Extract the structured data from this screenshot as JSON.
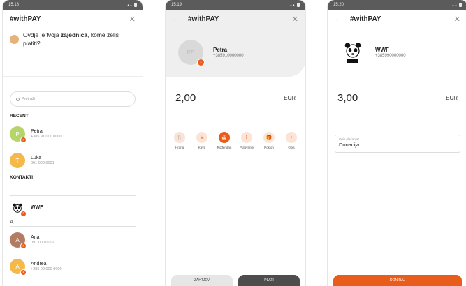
{
  "brand": {
    "accent": "#e85c1c",
    "status_bar": "#5b5b5b"
  },
  "screen1": {
    "time": "15:18",
    "title": "#withPAY",
    "intro_pre": "Ovdje je tvoja ",
    "intro_bold": "zajednica",
    "intro_post": ", kome želiš platiti?",
    "search_placeholder": "Pretraži",
    "recent_label": "RECENT",
    "contacts_label": "KONTAKTI",
    "letter_a": "A",
    "recent": [
      {
        "initial": "P",
        "name": "Petra",
        "phone": "+385 91 000 0000",
        "color": "#b5d46a"
      },
      {
        "initial": "T",
        "name": "Luka",
        "phone": "091 000 0001",
        "color": "#f5b94a"
      }
    ],
    "wwf_name": "WWF",
    "contacts": [
      {
        "initial": "A",
        "name": "Ana",
        "phone": "091 000 0002",
        "color": "#b27c64"
      },
      {
        "initial": "A",
        "name": "Andrea",
        "phone": "+385 99 000 0000",
        "color": "#f5b94a"
      }
    ]
  },
  "screen2": {
    "time": "15:19",
    "title": "#withPAY",
    "avatar_initials": "PB",
    "name": "Petra",
    "phone": "+385910000000",
    "amount": "2,00",
    "currency": "EUR",
    "categories": [
      {
        "label": "Hrana",
        "icon": "🍴",
        "active": false
      },
      {
        "label": "Kava",
        "icon": "☕",
        "active": false
      },
      {
        "label": "Rođendan",
        "icon": "🎂",
        "active": true
      },
      {
        "label": "Putovanje",
        "icon": "✈",
        "active": false
      },
      {
        "label": "Poklon",
        "icon": "🎁",
        "active": false
      },
      {
        "label": "Opis",
        "icon": "+",
        "active": false
      }
    ],
    "request_label": "ZAHTJEV",
    "pay_label": "PLATI"
  },
  "screen3": {
    "time": "15:20",
    "title": "#withPAY",
    "name": "WWF",
    "phone": "+385990000000",
    "amount": "3,00",
    "currency": "EUR",
    "desc_label": "Opis plaćanja*",
    "desc_value": "Donacija",
    "donate_label": "DONIRAJ"
  }
}
